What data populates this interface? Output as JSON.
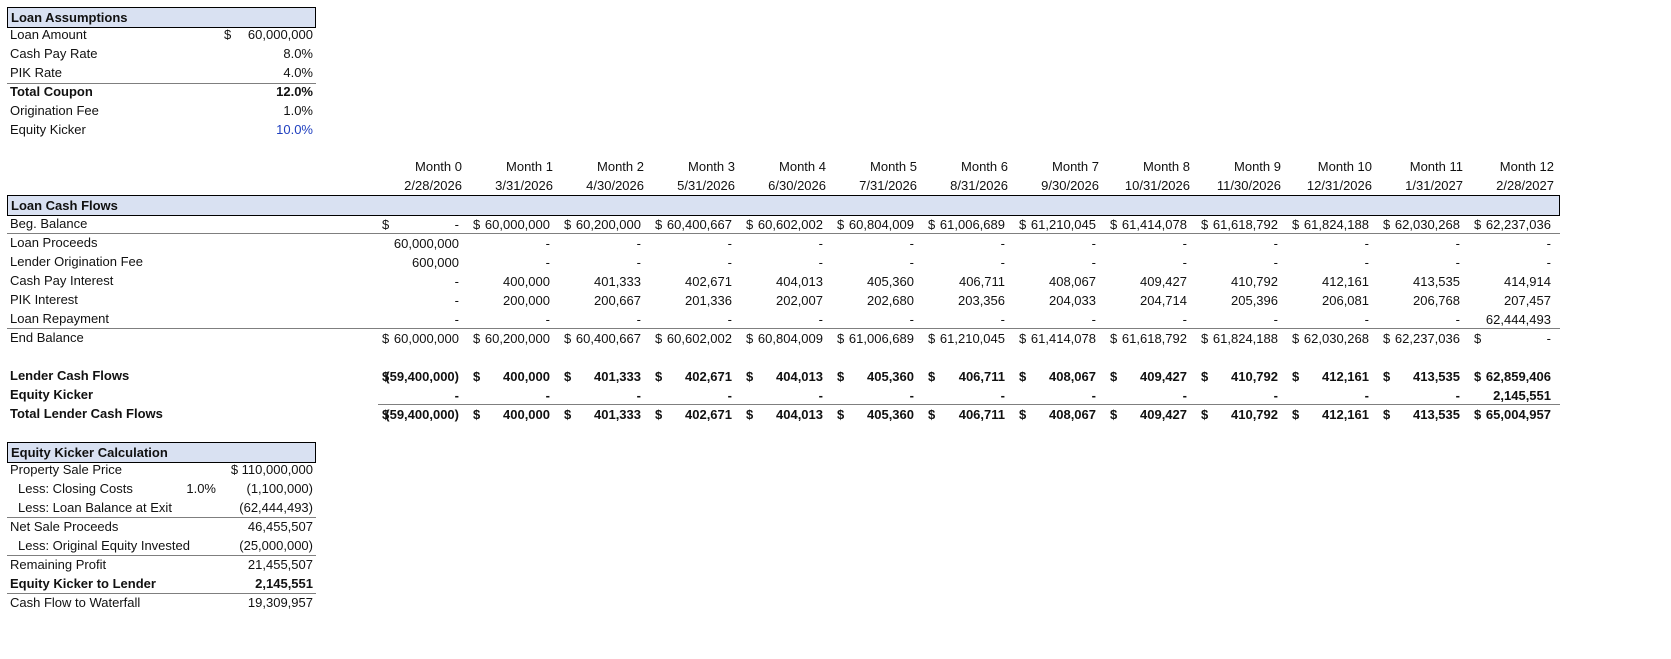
{
  "assumptions": {
    "title": "Loan Assumptions",
    "rows": [
      {
        "label": "Loan Amount",
        "currency": "$",
        "value": "60,000,000",
        "bold": false,
        "blue": false
      },
      {
        "label": "Cash Pay Rate",
        "currency": "",
        "value": "8.0%",
        "bold": false,
        "blue": false
      },
      {
        "label": "PIK Rate",
        "currency": "",
        "value": "4.0%",
        "bold": false,
        "blue": false
      },
      {
        "label": "Total Coupon",
        "currency": "",
        "value": "12.0%",
        "bold": true,
        "blue": false
      },
      {
        "label": "Origination Fee",
        "currency": "",
        "value": "1.0%",
        "bold": false,
        "blue": false
      },
      {
        "label": "Equity Kicker",
        "currency": "",
        "value": "10.0%",
        "bold": false,
        "blue": true
      }
    ]
  },
  "cashflows": {
    "title": "Loan Cash Flows",
    "months": [
      "Month 0",
      "Month 1",
      "Month 2",
      "Month 3",
      "Month 4",
      "Month 5",
      "Month 6",
      "Month 7",
      "Month 8",
      "Month 9",
      "Month 10",
      "Month 11",
      "Month 12"
    ],
    "dates": [
      "2/28/2026",
      "3/31/2026",
      "4/30/2026",
      "5/31/2026",
      "6/30/2026",
      "7/31/2026",
      "8/31/2026",
      "9/30/2026",
      "10/31/2026",
      "11/30/2026",
      "12/31/2026",
      "1/31/2027",
      "2/28/2027"
    ],
    "rows": [
      {
        "label": "Beg. Balance",
        "bold": false,
        "line_after": true,
        "cells": [
          [
            "$",
            "-"
          ],
          [
            "$",
            "60,000,000"
          ],
          [
            "$",
            "60,200,000"
          ],
          [
            "$",
            "60,400,667"
          ],
          [
            "$",
            "60,602,002"
          ],
          [
            "$",
            "60,804,009"
          ],
          [
            "$",
            "61,006,689"
          ],
          [
            "$",
            "61,210,045"
          ],
          [
            "$",
            "61,414,078"
          ],
          [
            "$",
            "61,618,792"
          ],
          [
            "$",
            "61,824,188"
          ],
          [
            "$",
            "62,030,268"
          ],
          [
            "$",
            "62,237,036"
          ]
        ]
      },
      {
        "label": "Loan Proceeds",
        "bold": false,
        "line_after": false,
        "cells": [
          [
            "",
            "60,000,000"
          ],
          [
            "",
            "-"
          ],
          [
            "",
            "-"
          ],
          [
            "",
            "-"
          ],
          [
            "",
            "-"
          ],
          [
            "",
            "-"
          ],
          [
            "",
            "-"
          ],
          [
            "",
            "-"
          ],
          [
            "",
            "-"
          ],
          [
            "",
            "-"
          ],
          [
            "",
            "-"
          ],
          [
            "",
            "-"
          ],
          [
            "",
            "-"
          ]
        ]
      },
      {
        "label": "Lender Origination Fee",
        "bold": false,
        "line_after": false,
        "cells": [
          [
            "",
            "600,000"
          ],
          [
            "",
            "-"
          ],
          [
            "",
            "-"
          ],
          [
            "",
            "-"
          ],
          [
            "",
            "-"
          ],
          [
            "",
            "-"
          ],
          [
            "",
            "-"
          ],
          [
            "",
            "-"
          ],
          [
            "",
            "-"
          ],
          [
            "",
            "-"
          ],
          [
            "",
            "-"
          ],
          [
            "",
            "-"
          ],
          [
            "",
            "-"
          ]
        ]
      },
      {
        "label": "Cash Pay Interest",
        "bold": false,
        "line_after": false,
        "cells": [
          [
            "",
            "-"
          ],
          [
            "",
            "400,000"
          ],
          [
            "",
            "401,333"
          ],
          [
            "",
            "402,671"
          ],
          [
            "",
            "404,013"
          ],
          [
            "",
            "405,360"
          ],
          [
            "",
            "406,711"
          ],
          [
            "",
            "408,067"
          ],
          [
            "",
            "409,427"
          ],
          [
            "",
            "410,792"
          ],
          [
            "",
            "412,161"
          ],
          [
            "",
            "413,535"
          ],
          [
            "",
            "414,914"
          ]
        ]
      },
      {
        "label": "PIK Interest",
        "bold": false,
        "line_after": false,
        "cells": [
          [
            "",
            "-"
          ],
          [
            "",
            "200,000"
          ],
          [
            "",
            "200,667"
          ],
          [
            "",
            "201,336"
          ],
          [
            "",
            "202,007"
          ],
          [
            "",
            "202,680"
          ],
          [
            "",
            "203,356"
          ],
          [
            "",
            "204,033"
          ],
          [
            "",
            "204,714"
          ],
          [
            "",
            "205,396"
          ],
          [
            "",
            "206,081"
          ],
          [
            "",
            "206,768"
          ],
          [
            "",
            "207,457"
          ]
        ]
      },
      {
        "label": "Loan Repayment",
        "bold": false,
        "line_after": true,
        "cells": [
          [
            "",
            "-"
          ],
          [
            "",
            "-"
          ],
          [
            "",
            "-"
          ],
          [
            "",
            "-"
          ],
          [
            "",
            "-"
          ],
          [
            "",
            "-"
          ],
          [
            "",
            "-"
          ],
          [
            "",
            "-"
          ],
          [
            "",
            "-"
          ],
          [
            "",
            "-"
          ],
          [
            "",
            "-"
          ],
          [
            "",
            "-"
          ],
          [
            "",
            "62,444,493"
          ]
        ]
      },
      {
        "label": "End Balance",
        "bold": false,
        "line_after": false,
        "cells": [
          [
            "$",
            "60,000,000"
          ],
          [
            "$",
            "60,200,000"
          ],
          [
            "$",
            "60,400,667"
          ],
          [
            "$",
            "60,602,002"
          ],
          [
            "$",
            "60,804,009"
          ],
          [
            "$",
            "61,006,689"
          ],
          [
            "$",
            "61,210,045"
          ],
          [
            "$",
            "61,414,078"
          ],
          [
            "$",
            "61,618,792"
          ],
          [
            "$",
            "61,824,188"
          ],
          [
            "$",
            "62,030,268"
          ],
          [
            "$",
            "62,237,036"
          ],
          [
            "$",
            "-"
          ]
        ]
      }
    ],
    "lender_rows": [
      {
        "label": "Lender Cash Flows",
        "line_after": false,
        "cells": [
          [
            "$",
            "(59,400,000)"
          ],
          [
            "$",
            "400,000"
          ],
          [
            "$",
            "401,333"
          ],
          [
            "$",
            "402,671"
          ],
          [
            "$",
            "404,013"
          ],
          [
            "$",
            "405,360"
          ],
          [
            "$",
            "406,711"
          ],
          [
            "$",
            "408,067"
          ],
          [
            "$",
            "409,427"
          ],
          [
            "$",
            "410,792"
          ],
          [
            "$",
            "412,161"
          ],
          [
            "$",
            "413,535"
          ],
          [
            "$",
            "62,859,406"
          ]
        ]
      },
      {
        "label": "Equity Kicker",
        "line_after": true,
        "cells": [
          [
            "",
            "-"
          ],
          [
            "",
            "-"
          ],
          [
            "",
            "-"
          ],
          [
            "",
            "-"
          ],
          [
            "",
            "-"
          ],
          [
            "",
            "-"
          ],
          [
            "",
            "-"
          ],
          [
            "",
            "-"
          ],
          [
            "",
            "-"
          ],
          [
            "",
            "-"
          ],
          [
            "",
            "-"
          ],
          [
            "",
            "-"
          ],
          [
            "",
            "2,145,551"
          ]
        ]
      },
      {
        "label": "Total Lender Cash Flows",
        "line_after": false,
        "cells": [
          [
            "$",
            "(59,400,000)"
          ],
          [
            "$",
            "400,000"
          ],
          [
            "$",
            "401,333"
          ],
          [
            "$",
            "402,671"
          ],
          [
            "$",
            "404,013"
          ],
          [
            "$",
            "405,360"
          ],
          [
            "$",
            "406,711"
          ],
          [
            "$",
            "408,067"
          ],
          [
            "$",
            "409,427"
          ],
          [
            "$",
            "410,792"
          ],
          [
            "$",
            "412,161"
          ],
          [
            "$",
            "413,535"
          ],
          [
            "$",
            "65,004,957"
          ]
        ]
      }
    ]
  },
  "kicker": {
    "title": "Equity Kicker Calculation",
    "rows": [
      {
        "label": "Property Sale Price",
        "indent": false,
        "pct": "",
        "value": "$ 110,000,000",
        "bold": false,
        "line_after": false
      },
      {
        "label": "Less: Closing Costs",
        "indent": true,
        "pct": "1.0%",
        "value": "(1,100,000)",
        "bold": false,
        "line_after": false
      },
      {
        "label": "Less: Loan Balance at Exit",
        "indent": true,
        "pct": "",
        "value": "(62,444,493)",
        "bold": false,
        "line_after": true
      },
      {
        "label": "Net Sale Proceeds",
        "indent": false,
        "pct": "",
        "value": "46,455,507",
        "bold": false,
        "line_after": false
      },
      {
        "label": "Less: Original Equity Invested",
        "indent": true,
        "pct": "",
        "value": "(25,000,000)",
        "bold": false,
        "line_after": true
      },
      {
        "label": "Remaining Profit",
        "indent": false,
        "pct": "",
        "value": "21,455,507",
        "bold": false,
        "line_after": false
      },
      {
        "label": "Equity Kicker to Lender",
        "indent": false,
        "pct": "",
        "value": "2,145,551",
        "bold": true,
        "line_after": true
      },
      {
        "label": "Cash Flow to Waterfall",
        "indent": false,
        "pct": "",
        "value": "19,309,957",
        "bold": false,
        "line_after": false
      }
    ]
  }
}
